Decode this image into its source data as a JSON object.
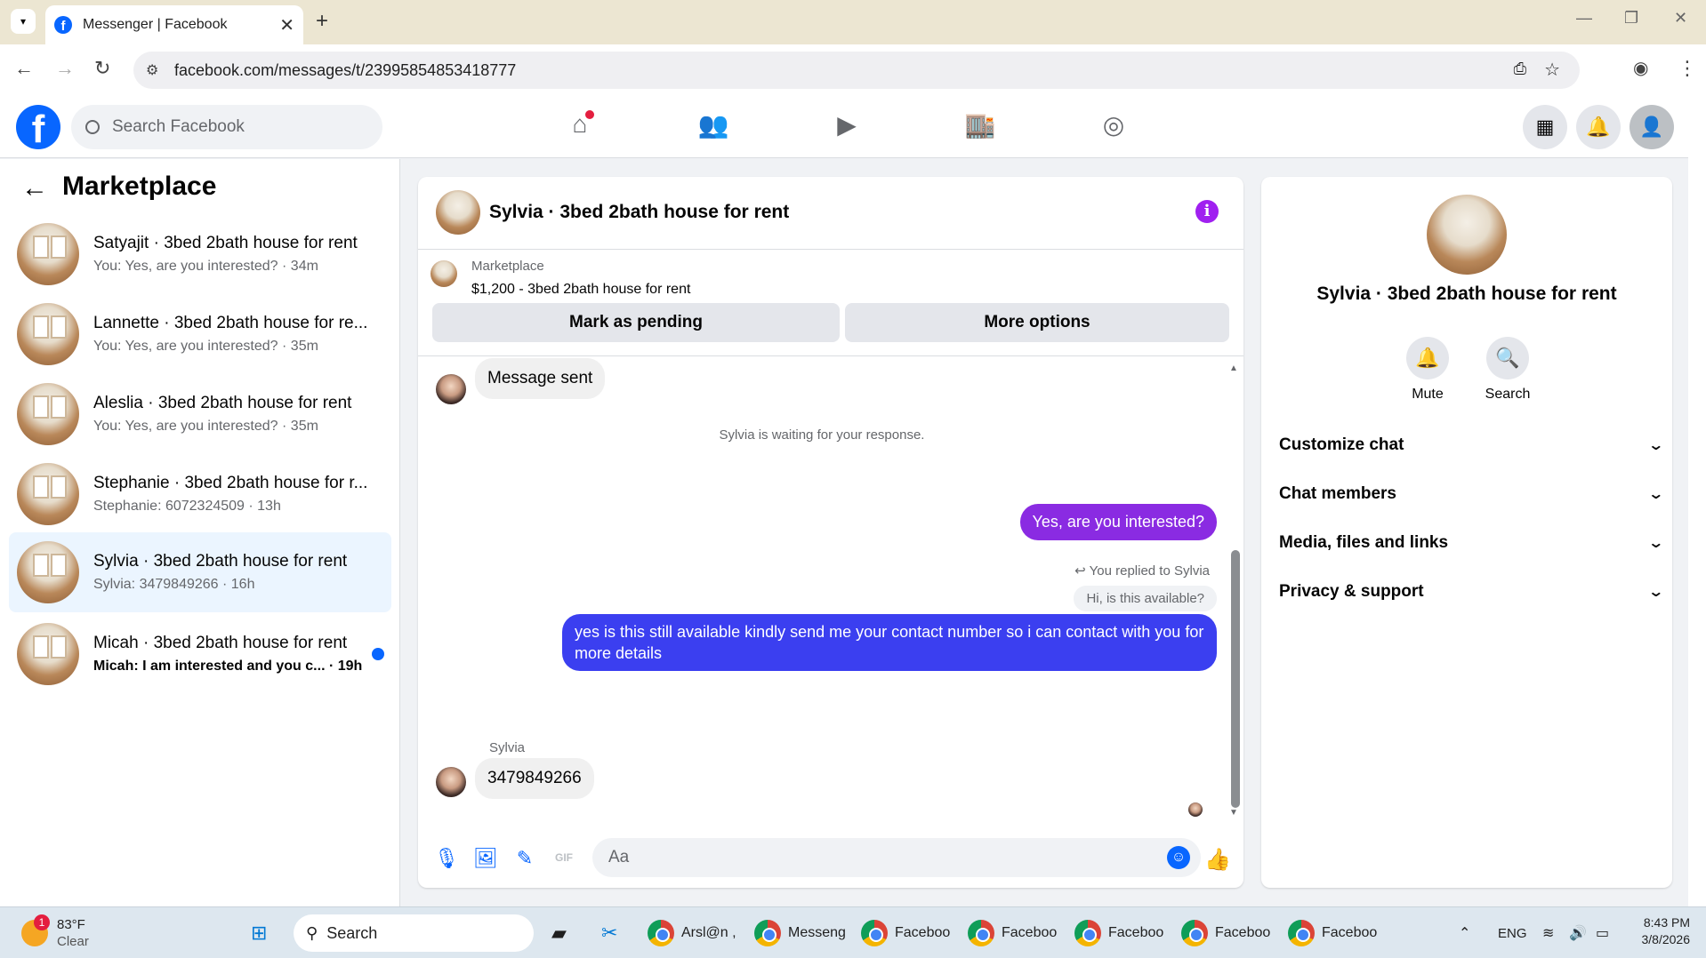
{
  "browser": {
    "tab_title": "Messenger | Facebook",
    "url": "facebook.com/messages/t/23995854853418777"
  },
  "fb": {
    "search_placeholder": "Search Facebook"
  },
  "left": {
    "title": "Marketplace",
    "conversations": [
      {
        "name": "Satyajit · 3bed 2bath house for rent",
        "preview": "You: Yes, are you interested? · 34m",
        "active": false,
        "unread": false
      },
      {
        "name": "Lannette · 3bed 2bath house for re...",
        "preview": "You: Yes, are you interested? · 35m",
        "active": false,
        "unread": false
      },
      {
        "name": "Aleslia · 3bed 2bath house for rent",
        "preview": "You: Yes, are you interested? · 35m",
        "active": false,
        "unread": false
      },
      {
        "name": "Stephanie · 3bed 2bath house for r...",
        "preview": "Stephanie: 6072324509 · 13h",
        "active": false,
        "unread": false
      },
      {
        "name": "Sylvia · 3bed 2bath house for rent",
        "preview": "Sylvia: 3479849266 · 16h",
        "active": true,
        "unread": false
      },
      {
        "name": "Micah · 3bed 2bath house for rent",
        "preview": "Micah: I am interested and you c... · 19h",
        "active": false,
        "unread": true
      }
    ]
  },
  "chat": {
    "title": "Sylvia · 3bed 2bath house for rent",
    "listing_label": "Marketplace",
    "listing_title": "$1,200 - 3bed 2bath house for rent",
    "mark_pending": "Mark as pending",
    "more_options": "More options",
    "msg_sent": "Message sent",
    "waiting": "Sylvia is waiting for your response.",
    "out1": "Yes, are you interested?",
    "replied_to": "You replied to Sylvia",
    "quoted": "Hi, is this available?",
    "out2": "yes is this still available kindly send me your contact number so i can contact with you for more details",
    "sender": "Sylvia",
    "in_number": "3479849266",
    "composer_placeholder": "Aa"
  },
  "right": {
    "name": "Sylvia · 3bed 2bath house for rent",
    "mute": "Mute",
    "search": "Search",
    "sections": [
      "Customize chat",
      "Chat members",
      "Media, files and links",
      "Privacy & support"
    ]
  },
  "taskbar": {
    "weather_temp": "83°F",
    "weather_desc": "Clear",
    "weather_badge": "1",
    "search": "Search",
    "apps": [
      "Arsl@n ,",
      "Messeng",
      "Faceboo",
      "Faceboo",
      "Faceboo",
      "Faceboo",
      "Faceboo"
    ],
    "lang": "ENG",
    "time": "8:43 PM",
    "date": "3/8/2026"
  },
  "colors": {
    "fb_blue": "#0866ff",
    "bubble_purple": "#8a2be2",
    "bubble_blue": "#3b3ff0",
    "active_row": "#ebf5ff"
  }
}
